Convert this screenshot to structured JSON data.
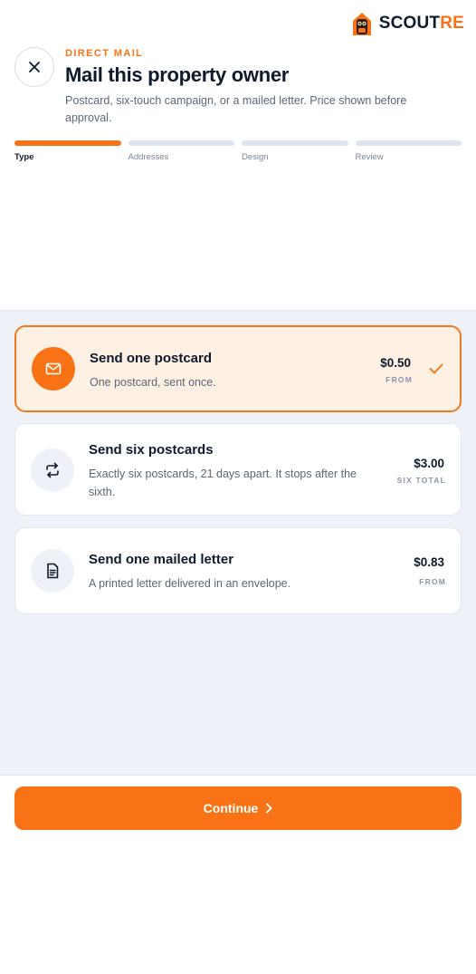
{
  "brand": {
    "name_main": "SCOUT",
    "name_accent": "RE"
  },
  "header": {
    "eyebrow": "DIRECT MAIL",
    "title": "Mail this property owner",
    "subtitle": "Postcard, six-touch campaign, or a mailed letter. Price shown before approval."
  },
  "steps": [
    {
      "label": "Type",
      "active": true
    },
    {
      "label": "Addresses",
      "active": false
    },
    {
      "label": "Design",
      "active": false
    },
    {
      "label": "Review",
      "active": false
    }
  ],
  "options": [
    {
      "title": "Send one postcard",
      "desc": "One postcard, sent once.",
      "price": "$0.50",
      "price_note": "FROM",
      "icon": "envelope-icon",
      "selected": true
    },
    {
      "title": "Send six postcards",
      "desc": "Exactly six postcards, 21 days apart. It stops after the sixth.",
      "price": "$3.00",
      "price_note": "SIX TOTAL",
      "icon": "repeat-icon",
      "selected": false
    },
    {
      "title": "Send one mailed letter",
      "desc": "A printed letter delivered in an envelope.",
      "price": "$0.83",
      "price_note": "FROM",
      "icon": "document-icon",
      "selected": false
    }
  ],
  "footer": {
    "continue_label": "Continue"
  },
  "colors": {
    "accent": "#f97316",
    "text": "#0f1b2d",
    "muted": "#5b6676",
    "panel": "#eef2f8"
  }
}
